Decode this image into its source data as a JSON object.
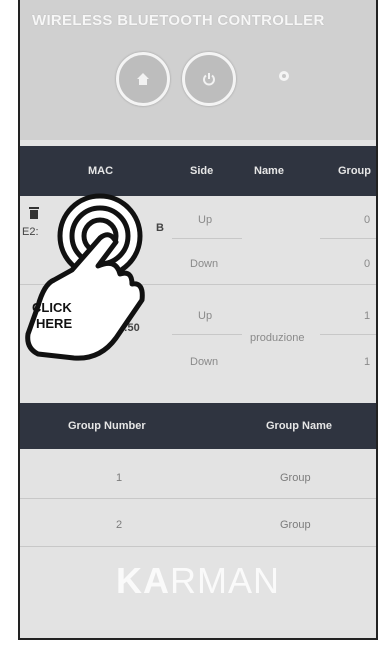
{
  "app": {
    "title": "WIRELESS BLUETOOTH CONTROLLER"
  },
  "device_table": {
    "headers": {
      "mac": "MAC",
      "side": "Side",
      "name": "Name",
      "group": "Group"
    },
    "rows": [
      {
        "mac_prefix": "E2:",
        "mac_suffix": "B",
        "sides": [
          "Up",
          "Down"
        ],
        "name": "",
        "groups": [
          "0",
          "0"
        ]
      },
      {
        "mac_visible": "A:95:50",
        "sides": [
          "Up",
          "Down"
        ],
        "name": "produzione",
        "groups": [
          "1",
          "1"
        ]
      }
    ]
  },
  "group_table": {
    "headers": {
      "number": "Group Number",
      "name": "Group Name"
    },
    "rows": [
      {
        "number": "1",
        "name": "Group"
      },
      {
        "number": "2",
        "name": "Group"
      }
    ]
  },
  "overlay": {
    "line1": "CLICK",
    "line2": "HERE"
  },
  "brand": {
    "bold": "KA",
    "rest": "RMAN"
  },
  "icons": {
    "home": "home-icon",
    "power": "power-icon",
    "settings": "gear-icon",
    "delete": "trash-icon",
    "pointer": "hand-pointer-icon"
  },
  "colors": {
    "header_bg": "#2f3440",
    "background": "#e3e3e3",
    "text_muted": "#8a8a8a"
  }
}
